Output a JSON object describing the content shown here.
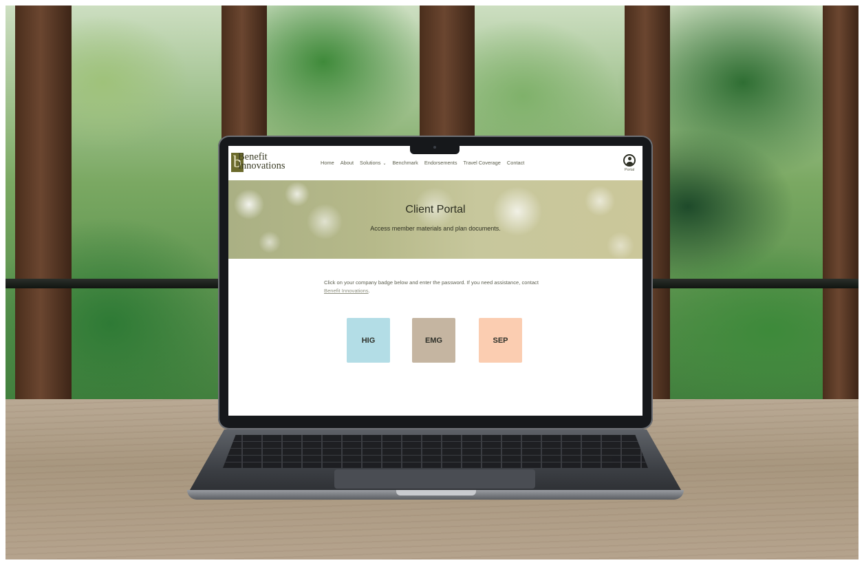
{
  "site": {
    "logo": {
      "line1": "Benefit",
      "line2": "Innovations"
    },
    "nav": [
      {
        "label": "Home"
      },
      {
        "label": "About"
      },
      {
        "label": "Solutions",
        "has_dropdown": true
      },
      {
        "label": "Benchmark"
      },
      {
        "label": "Endorsements"
      },
      {
        "label": "Travel Coverage"
      },
      {
        "label": "Contact"
      }
    ],
    "portal_label": "Portal"
  },
  "hero": {
    "title": "Client Portal",
    "subtitle": "Access member materials and plan documents."
  },
  "intro": {
    "text": "Click on your company badge below and enter the password. If you need assistance, contact ",
    "link_text": "Benefit Innovations",
    "end": "."
  },
  "badges": [
    {
      "label": "HIG",
      "color": "#b3dde6"
    },
    {
      "label": "EMG",
      "color": "#c5b5a1"
    },
    {
      "label": "SEP",
      "color": "#fbcdb1"
    }
  ],
  "colors": {
    "logo_mark": "#6b6a2c",
    "text_dark": "#2c2e20"
  }
}
